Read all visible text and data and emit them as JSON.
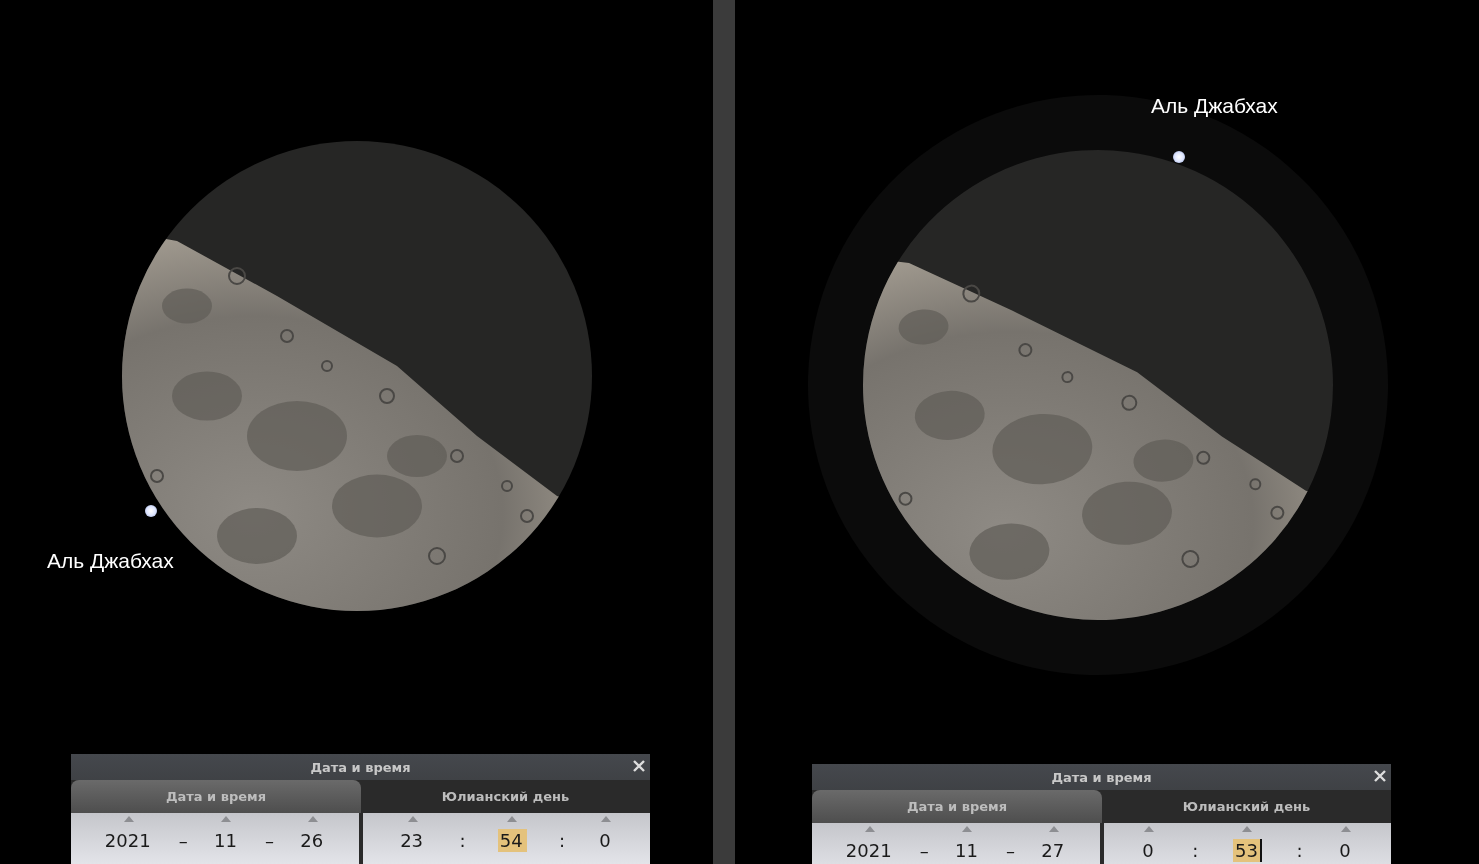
{
  "panels": [
    {
      "star_label": "Аль Джабхах",
      "dialog": {
        "title": "Дата и время",
        "tabs": [
          {
            "label": "Дата и время",
            "selected": true
          },
          {
            "label": "Юлианский день",
            "selected": false
          }
        ],
        "date": [
          {
            "kind": "field",
            "text": "2021",
            "selected": false,
            "focused": false
          },
          {
            "kind": "sep",
            "text": "–"
          },
          {
            "kind": "field",
            "text": "11",
            "selected": false,
            "focused": false
          },
          {
            "kind": "sep",
            "text": "–"
          },
          {
            "kind": "field",
            "text": "26",
            "selected": false,
            "focused": false
          }
        ],
        "time": [
          {
            "kind": "field",
            "text": "23",
            "selected": false,
            "focused": false
          },
          {
            "kind": "sep",
            "text": ":"
          },
          {
            "kind": "field",
            "text": "54",
            "selected": true,
            "focused": false
          },
          {
            "kind": "sep",
            "text": ":"
          },
          {
            "kind": "field",
            "text": "0",
            "selected": false,
            "focused": false
          }
        ]
      }
    },
    {
      "star_label": "Аль Джабхах",
      "dialog": {
        "title": "Дата и время",
        "tabs": [
          {
            "label": "Дата и время",
            "selected": true
          },
          {
            "label": "Юлианский день",
            "selected": false
          }
        ],
        "date": [
          {
            "kind": "field",
            "text": "2021",
            "selected": false,
            "focused": false
          },
          {
            "kind": "sep",
            "text": "–"
          },
          {
            "kind": "field",
            "text": "11",
            "selected": false,
            "focused": false
          },
          {
            "kind": "sep",
            "text": "–"
          },
          {
            "kind": "field",
            "text": "27",
            "selected": false,
            "focused": false
          }
        ],
        "time": [
          {
            "kind": "field",
            "text": "0",
            "selected": false,
            "focused": false
          },
          {
            "kind": "sep",
            "text": ":"
          },
          {
            "kind": "field",
            "text": "53",
            "selected": true,
            "focused": true
          },
          {
            "kind": "sep",
            "text": ":"
          },
          {
            "kind": "field",
            "text": "0",
            "selected": false,
            "focused": false
          }
        ]
      }
    }
  ]
}
